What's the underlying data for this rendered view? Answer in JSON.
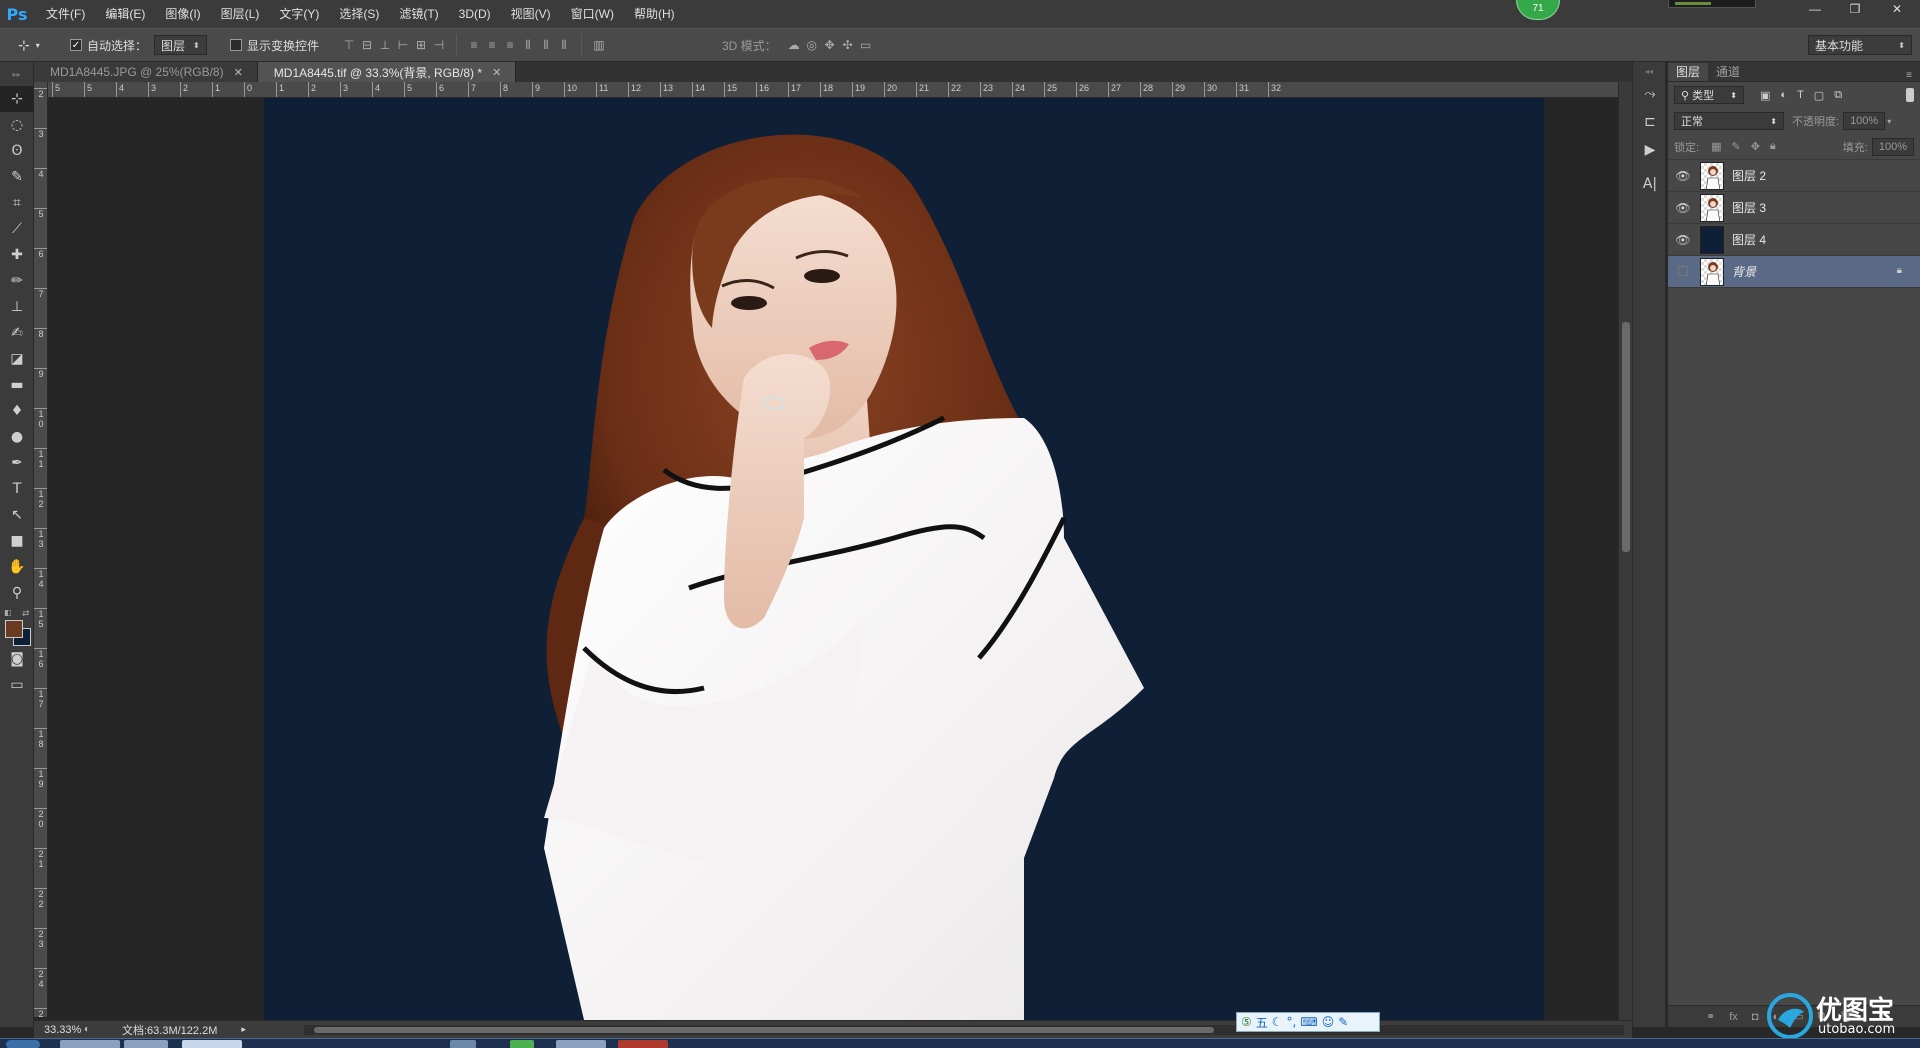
{
  "app": {
    "logo": "Ps",
    "badge": "71"
  },
  "menu": [
    "文件(F)",
    "编辑(E)",
    "图像(I)",
    "图层(L)",
    "文字(Y)",
    "选择(S)",
    "滤镜(T)",
    "3D(D)",
    "视图(V)",
    "窗口(W)",
    "帮助(H)"
  ],
  "window_controls": {
    "minimize": "—",
    "restore": "❐",
    "close": "✕"
  },
  "options": {
    "auto_select_label": "自动选择：",
    "auto_select_value": "图层",
    "show_transform_label": "显示变换控件",
    "mode_3d_label": "3D 模式：",
    "workspace": "基本功能"
  },
  "doc_tabs": [
    {
      "title": "MD1A8445.JPG @ 25%(RGB/8)",
      "active": false
    },
    {
      "title": "MD1A8445.tif @ 33.3%(背景, RGB/8) *",
      "active": true
    }
  ],
  "ruler_h_labels": [
    "5",
    "5",
    "4",
    "3",
    "2",
    "1",
    "0",
    "1",
    "2",
    "3",
    "4",
    "5",
    "6",
    "7",
    "8",
    "9",
    "10",
    "11",
    "12",
    "13",
    "14",
    "15",
    "16",
    "17",
    "18",
    "19",
    "20",
    "21",
    "22",
    "23",
    "24",
    "25",
    "26",
    "27",
    "28",
    "29",
    "30",
    "31",
    "32"
  ],
  "ruler_v_labels": [
    "2",
    "3",
    "4",
    "5",
    "6",
    "7",
    "8",
    "9",
    "10",
    "11",
    "12",
    "13",
    "14",
    "15",
    "16",
    "17",
    "18",
    "19",
    "20",
    "21",
    "22",
    "23",
    "24",
    "25"
  ],
  "status": {
    "zoom": "33.33%",
    "doc_info": "文档:63.3M/122.2M"
  },
  "layers_panel": {
    "tabs": [
      "图层",
      "通道"
    ],
    "filter_label": "类型",
    "blend_mode": "正常",
    "opacity_label": "不透明度:",
    "opacity_value": "100%",
    "lock_label": "锁定:",
    "fill_label": "填充:",
    "fill_value": "100%",
    "layers": [
      {
        "name": "图层 2",
        "visible": true,
        "thumb": "person",
        "selected": false,
        "locked": false
      },
      {
        "name": "图层 3",
        "visible": true,
        "thumb": "person",
        "selected": false,
        "locked": false
      },
      {
        "name": "图层 4",
        "visible": true,
        "thumb": "navy",
        "selected": false,
        "locked": false
      },
      {
        "name": "背景",
        "visible": false,
        "thumb": "person",
        "selected": true,
        "locked": true
      }
    ],
    "bottom_icons": [
      "link-icon",
      "fx-icon",
      "mask-icon",
      "adjust-icon",
      "folder-icon",
      "new-layer-icon",
      "trash-icon"
    ],
    "bottom_fx": "fx"
  },
  "ime": {
    "label": "五"
  },
  "watermark": {
    "title": "优图宝",
    "url": "utobao.com"
  },
  "colors": {
    "canvas_bg": "#0f2036",
    "foreground": "#6b3a22",
    "background": "#0f2036",
    "selection": "#5a6a86"
  }
}
